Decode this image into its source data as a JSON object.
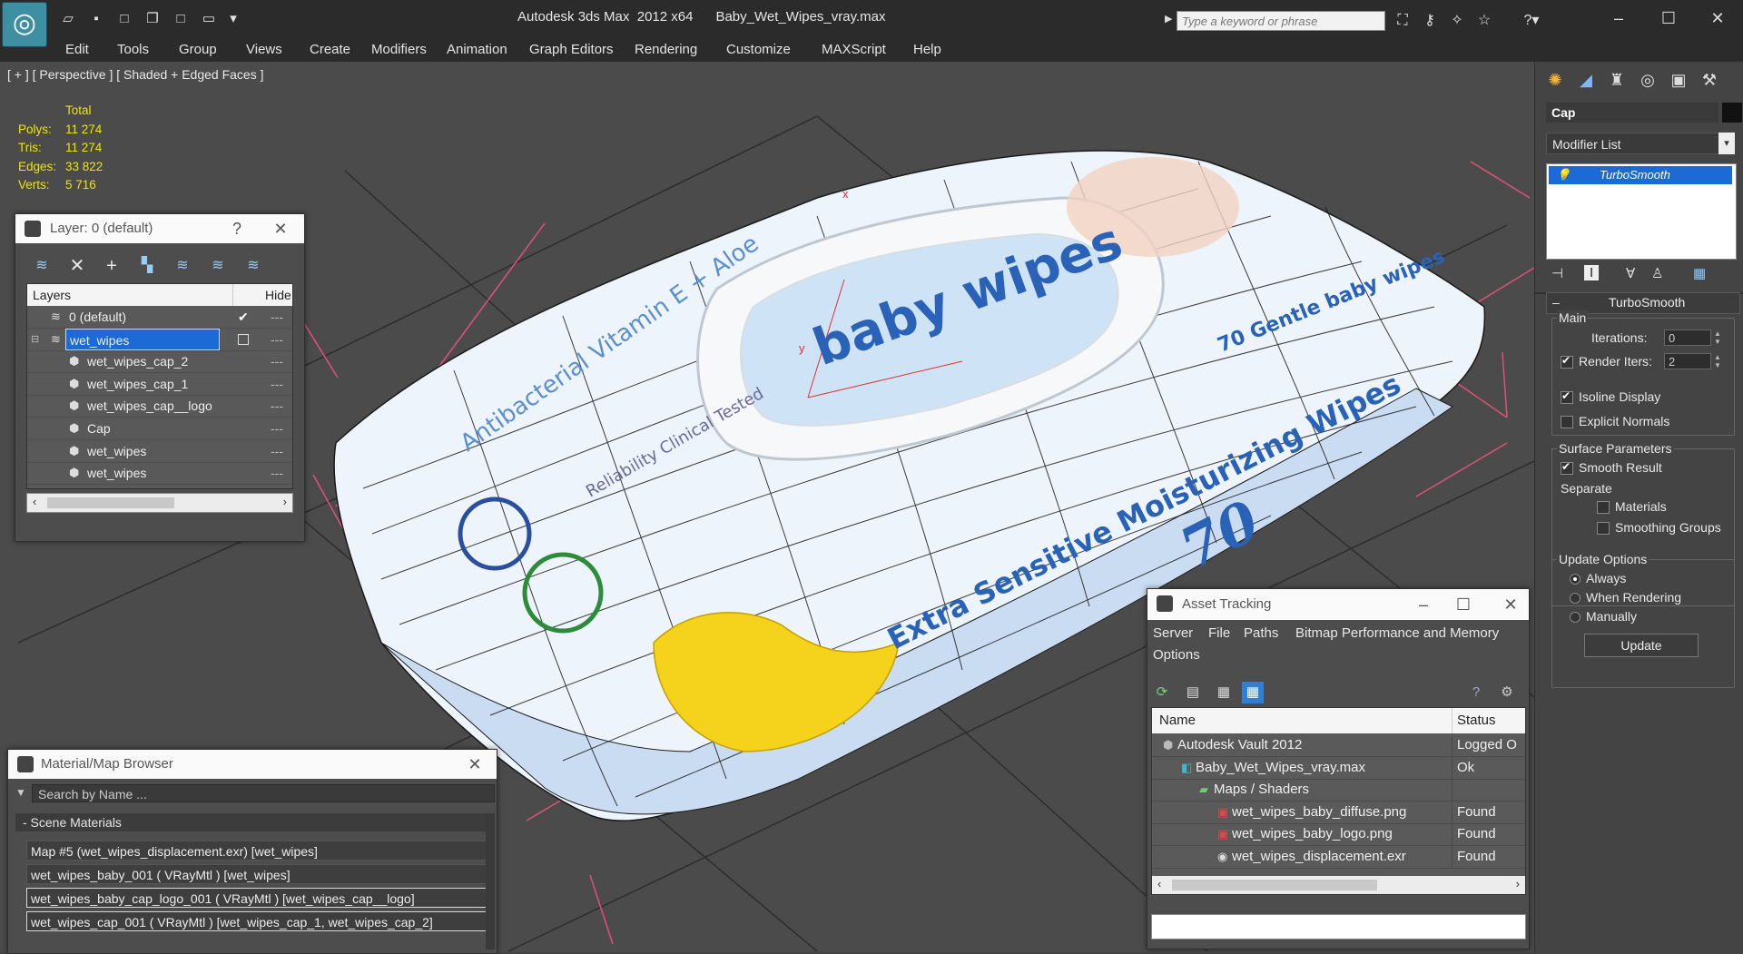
{
  "titlebar": {
    "title": "Autodesk 3ds Max  2012 x64      Baby_Wet_Wipes_vray.max",
    "search_placeholder": "Type a keyword or phrase",
    "quick_access": [
      "open-icon",
      "save-icon",
      "new-icon",
      "copy-icon",
      "window-icon",
      "window-alt-icon",
      "dropdown-icon"
    ],
    "info_icons": [
      "binoculars-icon",
      "key-icon",
      "star-connect-icon",
      "star-icon",
      "help-icon"
    ]
  },
  "menu": [
    "Edit",
    "Tools",
    "Group",
    "Views",
    "Create",
    "Modifiers",
    "Animation",
    "Graph Editors",
    "Rendering",
    "Customize",
    "MAXScript",
    "Help"
  ],
  "viewport": {
    "label": "[ + ] [ Perspective ] [ Shaded + Edged Faces ]",
    "stats": {
      "header": "Total",
      "rows": [
        {
          "label": "Polys:",
          "value": "11 274"
        },
        {
          "label": "Tris:",
          "value": "11 274"
        },
        {
          "label": "Edges:",
          "value": "33 822"
        },
        {
          "label": "Verts:",
          "value": "5 716"
        }
      ]
    },
    "product_text": {
      "logo": "baby wipes",
      "banner": "Extra Sensitive Moisturizing Wipes",
      "count": "70",
      "badge": "70 Gentle baby wipes",
      "side": "Antibacterial Vitamin E + Aloe",
      "tested": "Reliability Clinical Tested",
      "axis_x": "x",
      "axis_y": "y"
    }
  },
  "layer_window": {
    "title": "Layer: 0 (default)",
    "help": "?",
    "close": "✕",
    "col_layers": "Layers",
    "col_hide": "Hide",
    "rows": [
      {
        "name": "0 (default)",
        "indent": 0,
        "selected": false,
        "current": true
      },
      {
        "name": "wet_wipes",
        "indent": 0,
        "selected": true,
        "current": false
      },
      {
        "name": "wet_wipes_cap_2",
        "indent": 1,
        "selected": false,
        "current": false
      },
      {
        "name": "wet_wipes_cap_1",
        "indent": 1,
        "selected": false,
        "current": false
      },
      {
        "name": "wet_wipes_cap__logo",
        "indent": 1,
        "selected": false,
        "current": false
      },
      {
        "name": "Cap",
        "indent": 1,
        "selected": false,
        "current": false
      },
      {
        "name": "wet_wipes",
        "indent": 1,
        "selected": false,
        "current": false
      },
      {
        "name": "wet_wipes",
        "indent": 1,
        "selected": false,
        "current": false
      }
    ]
  },
  "material_browser": {
    "title": "Material/Map Browser",
    "close": "✕",
    "search_placeholder": "Search by Name ...",
    "group": "- Scene Materials",
    "items": [
      "Map #5 (wet_wipes_displacement.exr)  [wet_wipes]",
      "wet_wipes_baby_001  ( VRayMtl )  [wet_wipes]",
      "wet_wipes_baby_cap_logo_001  ( VRayMtl ) [wet_wipes_cap__logo]",
      "wet_wipes_cap_001  ( VRayMtl )  [wet_wipes_cap_1, wet_wipes_cap_2]"
    ]
  },
  "asset_tracking": {
    "title": "Asset Tracking",
    "menu": [
      "Server",
      "File",
      "Paths",
      "Bitmap Performance and Memory",
      "Options"
    ],
    "col_name": "Name",
    "col_status": "Status",
    "rows": [
      {
        "name": "Autodesk Vault 2012",
        "status": "Logged O",
        "indent": 1,
        "icon": "vault-icon"
      },
      {
        "name": "Baby_Wet_Wipes_vray.max",
        "status": "Ok",
        "indent": 2,
        "icon": "max-file-icon"
      },
      {
        "name": "Maps / Shaders",
        "status": "",
        "indent": 3,
        "icon": "maps-folder-icon"
      },
      {
        "name": "wet_wipes_baby_diffuse.png",
        "status": "Found",
        "indent": 4,
        "icon": "png-file-icon"
      },
      {
        "name": "wet_wipes_baby_logo.png",
        "status": "Found",
        "indent": 4,
        "icon": "png-file-icon"
      },
      {
        "name": "wet_wipes_displacement.exr",
        "status": "Found",
        "indent": 4,
        "icon": "exr-file-icon"
      }
    ]
  },
  "command_panel": {
    "object_name": "Cap",
    "modifier_list": "Modifier List",
    "stack_item": "TurboSmooth",
    "rollout_title": "TurboSmooth",
    "main_group": "Main",
    "iterations_label": "Iterations:",
    "iterations_value": "0",
    "render_iters_label": "Render Iters:",
    "render_iters_value": "2",
    "render_iters_checked": true,
    "isoline_label": "Isoline Display",
    "isoline_checked": true,
    "explicit_label": "Explicit Normals",
    "explicit_checked": false,
    "surface_group": "Surface Parameters",
    "smooth_result_label": "Smooth Result",
    "smooth_result_checked": true,
    "separate_label": "Separate",
    "materials_label": "Materials",
    "materials_checked": false,
    "smoothing_groups_label": "Smoothing Groups",
    "smoothing_groups_checked": false,
    "update_group": "Update Options",
    "radio_always": "Always",
    "radio_when_rendering": "When Rendering",
    "radio_manually": "Manually",
    "radio_selected": "Always",
    "update_button": "Update"
  },
  "colors": {
    "stats_yellow": "#f0e600",
    "selection_blue": "#1c6ad6",
    "grid_pink": "#e0507a",
    "package_blue": "#2a62b8"
  }
}
